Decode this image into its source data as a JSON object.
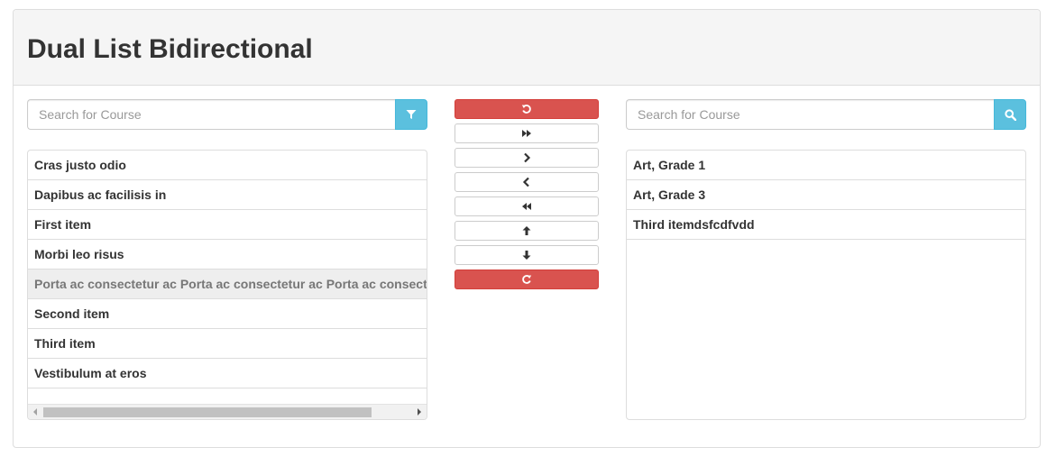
{
  "panel": {
    "title": "Dual List Bidirectional"
  },
  "left": {
    "search_placeholder": "Search for Course",
    "search_icon": "filter-icon",
    "items": [
      {
        "label": "Cras justo odio",
        "selected": false
      },
      {
        "label": "Dapibus ac facilisis in",
        "selected": false
      },
      {
        "label": "First item",
        "selected": false
      },
      {
        "label": "Morbi leo risus",
        "selected": false
      },
      {
        "label": "Porta ac consectetur ac Porta ac consectetur ac Porta ac consectetur ac",
        "selected": true
      },
      {
        "label": "Second item",
        "selected": false
      },
      {
        "label": "Third item",
        "selected": false
      },
      {
        "label": "Vestibulum at eros",
        "selected": false
      }
    ]
  },
  "right": {
    "search_placeholder": "Search for Course",
    "search_icon": "search-icon",
    "items": [
      {
        "label": "Art, Grade 1"
      },
      {
        "label": "Art, Grade 3"
      },
      {
        "label": "Third itemdsfcdfvdd"
      }
    ]
  },
  "buttons": [
    {
      "name": "undo-button",
      "icon": "undo-icon",
      "style": "danger"
    },
    {
      "name": "move-all-right-button",
      "icon": "fast-forward-icon",
      "style": "default"
    },
    {
      "name": "move-right-button",
      "icon": "chevron-right-icon",
      "style": "default"
    },
    {
      "name": "move-left-button",
      "icon": "chevron-left-icon",
      "style": "default"
    },
    {
      "name": "move-all-left-button",
      "icon": "fast-backward-icon",
      "style": "default"
    },
    {
      "name": "move-up-button",
      "icon": "arrow-up-icon",
      "style": "default"
    },
    {
      "name": "move-down-button",
      "icon": "arrow-down-icon",
      "style": "default"
    },
    {
      "name": "redo-button",
      "icon": "redo-icon",
      "style": "danger"
    }
  ],
  "colors": {
    "danger": "#d9534f",
    "info": "#5bc0de",
    "heading_bg": "#f5f5f5",
    "selected_bg": "#eeeeee"
  }
}
